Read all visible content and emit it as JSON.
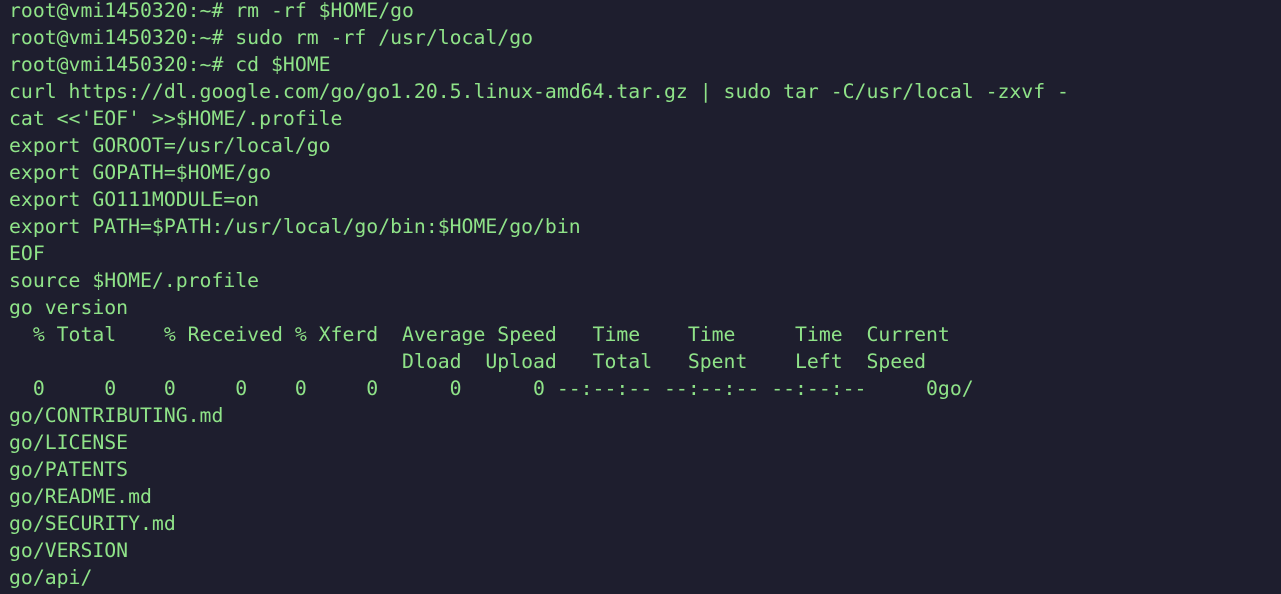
{
  "terminal": {
    "lines": [
      "root@vmi1450320:~# rm -rf $HOME/go",
      "root@vmi1450320:~# sudo rm -rf /usr/local/go",
      "root@vmi1450320:~# cd $HOME",
      "curl https://dl.google.com/go/go1.20.5.linux-amd64.tar.gz | sudo tar -C/usr/local -zxvf -",
      "cat <<'EOF' >>$HOME/.profile",
      "export GOROOT=/usr/local/go",
      "export GOPATH=$HOME/go",
      "export GO111MODULE=on",
      "export PATH=$PATH:/usr/local/go/bin:$HOME/go/bin",
      "EOF",
      "source $HOME/.profile",
      "go version",
      "  % Total    % Received % Xferd  Average Speed   Time    Time     Time  Current",
      "                                 Dload  Upload   Total   Spent    Left  Speed",
      "  0     0    0     0    0     0      0      0 --:--:-- --:--:-- --:--:--     0go/",
      "go/CONTRIBUTING.md",
      "go/LICENSE",
      "go/PATENTS",
      "go/README.md",
      "go/SECURITY.md",
      "go/VERSION",
      "go/api/"
    ]
  },
  "colors": {
    "background": "#1e1e2e",
    "text": "#8fe388"
  }
}
